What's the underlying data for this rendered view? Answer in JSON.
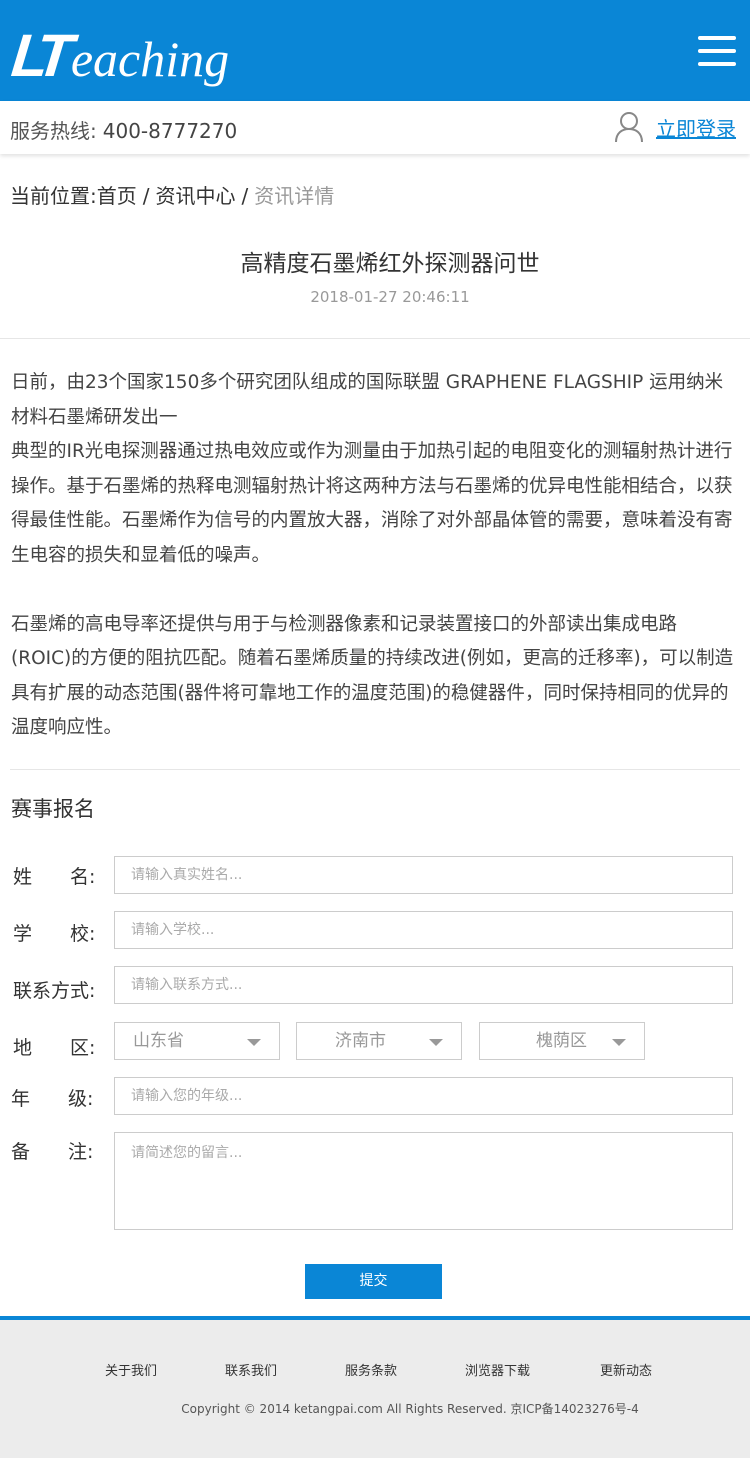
{
  "header": {
    "logo_mark": "LT",
    "logo_text": "eaching",
    "menu_icon": "hamburger-menu-icon",
    "hotline_label": "服务热线:",
    "hotline_number": "400-8777270",
    "user_icon": "user-icon",
    "login_label": "立即登录"
  },
  "breadcrumb": {
    "prefix": "当前位置:",
    "items": [
      "首页",
      "资讯中心"
    ],
    "separator": "/",
    "current": "资讯详情"
  },
  "article": {
    "title": "高精度石墨烯红外探测器问世",
    "date": "2018-01-27 20:46:11",
    "paragraphs": [
      "日前，由23个国家150多个研究团队组成的国际联盟 GRAPHENE FLAGSHIP 运用纳米材料石墨烯研发出一",
      "典型的IR光电探测器通过热电效应或作为测量由于加热引起的电阻变化的测辐射热计进行操作。基于石墨烯的热释电测辐射热计将这两种方法与石墨烯的优异电性能相结合，以获得最佳性能。石墨烯作为信号的内置放大器，消除了对外部晶体管的需要，意味着没有寄生电容的损失和显着低的噪声。",
      "石墨烯的高电导率还提供与用于与检测器像素和记录装置接口的外部读出集成电路(ROIC)的方便的阻抗匹配。随着石墨烯质量的持续改进(例如，更高的迁移率)，可以制造具有扩展的动态范围(器件将可靠地工作的温度范围)的稳健器件，同时保持相同的优异的温度响应性。"
    ]
  },
  "form": {
    "title": "赛事报名",
    "name_label": "姓　　名:",
    "name_placeholder": "请输入真实姓名...",
    "school_label": "学　　校:",
    "school_placeholder": "请输入学校...",
    "contact_label": "联系方式:",
    "contact_placeholder": "请输入联系方式...",
    "region_label": "地　　区:",
    "province": "山东省",
    "city": "济南市",
    "district": "槐荫区",
    "grade_label": "年　　级:",
    "grade_placeholder": "请输入您的年级...",
    "note_label": "备　　注:",
    "note_placeholder": "请简述您的留言...",
    "submit_label": "提交"
  },
  "footer": {
    "links": [
      "关于我们",
      "联系我们",
      "服务条款",
      "浏览器下载",
      "更新动态"
    ],
    "copyright": "Copyright © 2014 ketangpai.com All Rights Reserved. 京ICP备14023276号-4"
  },
  "colors": {
    "brand": "#0a86d6",
    "footer_bg": "#ececec"
  }
}
